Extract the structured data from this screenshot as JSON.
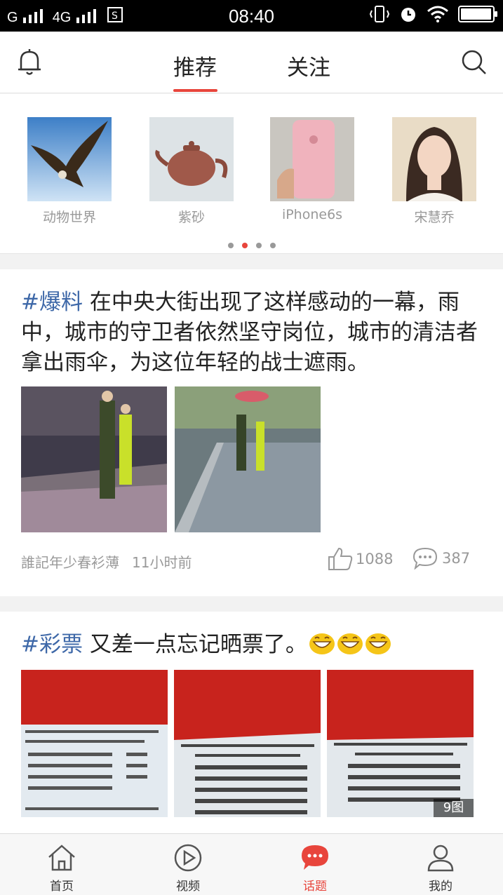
{
  "status_bar": {
    "carrier1": "G",
    "carrier2": "4G",
    "time": "08:40"
  },
  "header": {
    "tabs": [
      {
        "label": "推荐",
        "active": true
      },
      {
        "label": "关注",
        "active": false
      }
    ],
    "accent_color": "#e8453c"
  },
  "topics": [
    {
      "label": "动物世界",
      "icon": "eagle-thumbnail"
    },
    {
      "label": "紫砂",
      "icon": "teapot-thumbnail"
    },
    {
      "label": "iPhone6s",
      "icon": "phone-thumbnail"
    },
    {
      "label": "宋慧乔",
      "icon": "portrait-thumbnail"
    }
  ],
  "carousel": {
    "pages": 4,
    "active_index": 1
  },
  "posts": [
    {
      "hashtag": "#爆料",
      "text": " 在中央大街出现了这样感动的一幕，雨中，城市的守卫者依然坚守岗位，城市的清洁者拿出雨伞，为这位年轻的战士遮雨。",
      "author": "誰記年少春衫薄",
      "time": "11小时前",
      "likes": "1088",
      "comments": "387"
    },
    {
      "hashtag": "#彩票",
      "text": " 又差一点忘记晒票了。",
      "emoji": "grinning-face",
      "image_count": "9图"
    }
  ],
  "bottom_nav": [
    {
      "label": "首页",
      "icon": "home-icon"
    },
    {
      "label": "视频",
      "icon": "video-play-icon"
    },
    {
      "label": "话题",
      "icon": "topic-chat-icon",
      "active": true
    },
    {
      "label": "我的",
      "icon": "user-icon"
    }
  ]
}
